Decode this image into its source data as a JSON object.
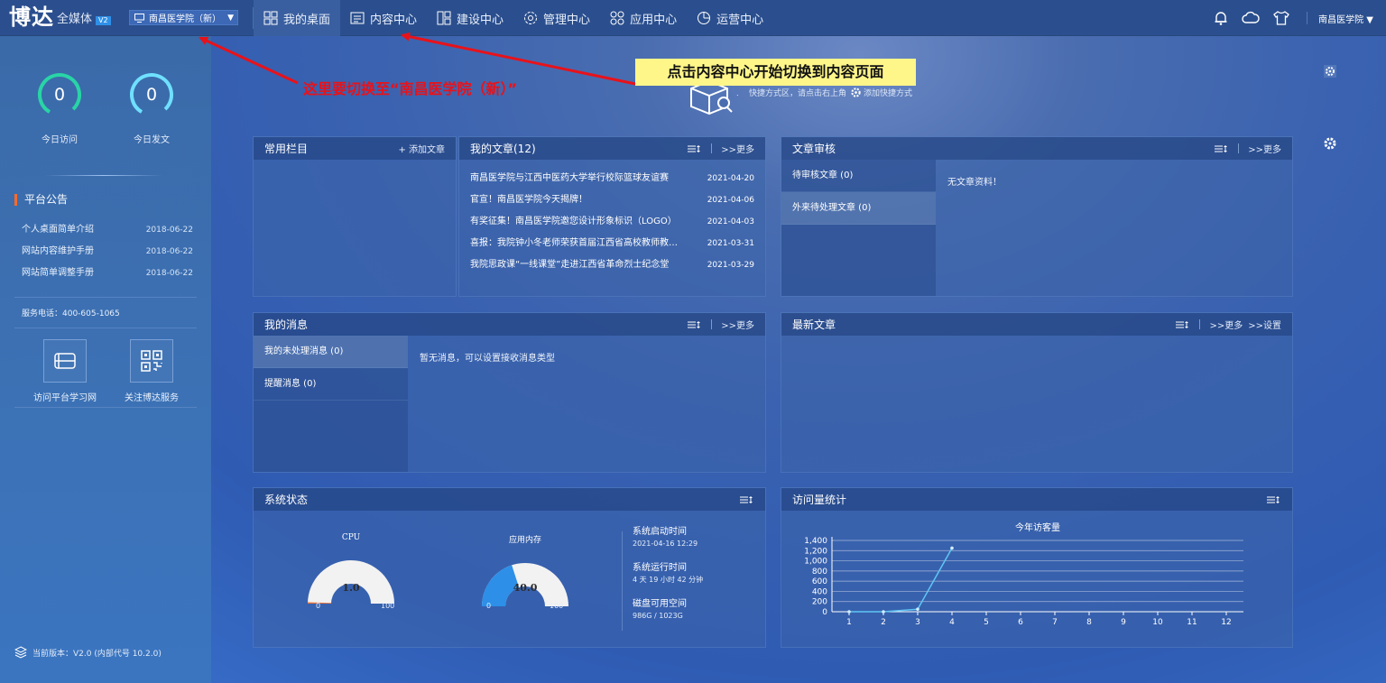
{
  "header": {
    "logo_main": "博达",
    "logo_sub": "全媒体",
    "logo_version": "V2",
    "school_selector": "南昌医学院（新）",
    "nav": [
      {
        "label": "我的桌面",
        "icon": "grid-icon",
        "active": true
      },
      {
        "label": "内容中心",
        "icon": "document-icon",
        "active": false
      },
      {
        "label": "建设中心",
        "icon": "layout-icon",
        "active": false
      },
      {
        "label": "管理中心",
        "icon": "gear-icon",
        "active": false
      },
      {
        "label": "应用中心",
        "icon": "apps-icon",
        "active": false
      },
      {
        "label": "运营中心",
        "icon": "pie-icon",
        "active": false
      }
    ],
    "user": "南昌医学院"
  },
  "sidebar": {
    "visits_value": "0",
    "visits_label": "今日访问",
    "posts_value": "0",
    "posts_label": "今日发文",
    "notice_title": "平台公告",
    "notices": [
      {
        "title": "个人桌面简单介绍",
        "date": "2018-06-22"
      },
      {
        "title": "网站内容维护手册",
        "date": "2018-06-22"
      },
      {
        "title": "网站简单调整手册",
        "date": "2018-06-22"
      }
    ],
    "service_phone": "服务电话：400-605-1065",
    "quick_links": [
      {
        "label": "访问平台学习网",
        "icon": "book-icon"
      },
      {
        "label": "关注博达服务",
        "icon": "qrcode-icon"
      }
    ],
    "version": "当前版本：V2.0 (内部代号 10.2.0)"
  },
  "shortcut": {
    "hint_prefix": "快捷方式区，请点击右上角",
    "hint_suffix": "添加快捷方式"
  },
  "panels": {
    "common": {
      "title": "常用栏目",
      "add_label": "+ 添加文章"
    },
    "my_articles": {
      "title": "我的文章(12)",
      "more": ">>更多",
      "items": [
        {
          "title": "南昌医学院与江西中医药大学举行校际篮球友谊赛",
          "date": "2021-04-20"
        },
        {
          "title": "官宣！南昌医学院今天揭牌！",
          "date": "2021-04-06"
        },
        {
          "title": "有奖征集！南昌医学院邀您设计形象标识（LOGO）",
          "date": "2021-04-03"
        },
        {
          "title": "喜报：我院钟小冬老师荣获首届江西省高校教师教学…",
          "date": "2021-03-31"
        },
        {
          "title": "我院思政课“一线课堂”走进江西省革命烈士纪念堂",
          "date": "2021-03-29"
        }
      ]
    },
    "review": {
      "title": "文章审核",
      "more": ">>更多",
      "tabs": [
        "待审核文章 (0)",
        "外来待处理文章 (0)"
      ],
      "empty": "无文章资料！"
    },
    "messages": {
      "title": "我的消息",
      "more": ">>更多",
      "tabs": [
        "我的未处理消息 (0)",
        "提醒消息 (0)"
      ],
      "empty": "暂无消息，可以设置接收消息类型"
    },
    "latest": {
      "title": "最新文章",
      "more": ">>更多",
      "settings": ">>设置"
    },
    "system": {
      "title": "系统状态",
      "cpu": {
        "label": "CPU",
        "value": 1.0,
        "value_text": "1.0",
        "min": "0",
        "max": "100"
      },
      "mem": {
        "label": "应用内存",
        "value": 40.0,
        "value_text": "40.0",
        "min": "0",
        "max": "100"
      },
      "start_label": "系统启动时间",
      "start_value": "2021-04-16 12:29",
      "uptime_label": "系统运行时间",
      "uptime_value": "4 天 19 小时 42 分钟",
      "disk_label": "磁盘可用空间",
      "disk_value": "986G / 1023G"
    },
    "visits": {
      "title": "访问量统计"
    }
  },
  "chart_data": {
    "type": "line",
    "title": "今年访客量",
    "categories": [
      "1",
      "2",
      "3",
      "4",
      "5",
      "6",
      "7",
      "8",
      "9",
      "10",
      "11",
      "12"
    ],
    "values": [
      0,
      0,
      50,
      1250,
      null,
      null,
      null,
      null,
      null,
      null,
      null,
      null
    ],
    "yticks": [
      "0",
      "200",
      "400",
      "600",
      "800",
      "1,000",
      "1,200",
      "1,400"
    ],
    "ylim": [
      0,
      1400
    ],
    "grid": true
  },
  "annotations": {
    "callout": "点击内容中心开始切换到内容页面",
    "red_note": "这里要切换至“南昌医学院（新）”"
  },
  "colors": {
    "header_bg": "#2b4f8e",
    "ring_visits": "#29d4a6",
    "ring_posts": "#6fe0ff",
    "gauge_fill": "#2d8fe8",
    "gauge_bg": "#f2f2f2",
    "notice_bar": "#ff6a2a",
    "annotation_red": "#e8121a",
    "callout_bg": "#fff68a"
  }
}
